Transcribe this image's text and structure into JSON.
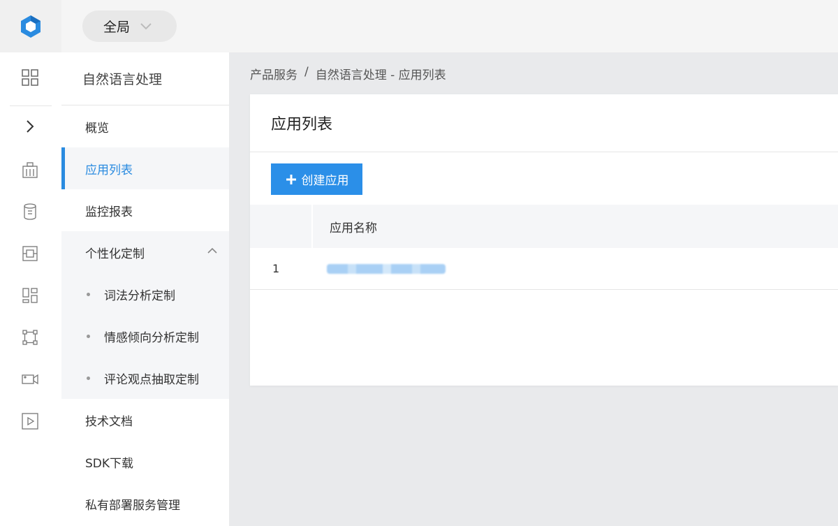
{
  "topbar": {
    "scope_label": "全局"
  },
  "rail": {
    "icons": [
      "logo-cube-icon",
      "grid-icon",
      "chevron-right-icon",
      "building-icon",
      "database-icon",
      "chip-icon",
      "dashboard-icon",
      "network-icon",
      "video-camera-icon",
      "play-icon"
    ]
  },
  "sidebar": {
    "title": "自然语言处理",
    "items": [
      {
        "label": "概览"
      },
      {
        "label": "应用列表"
      },
      {
        "label": "监控报表"
      },
      {
        "label": "个性化定制"
      },
      {
        "label": "技术文档"
      },
      {
        "label": "SDK下载"
      },
      {
        "label": "私有部署服务管理"
      }
    ],
    "sub_items": [
      {
        "label": "词法分析定制"
      },
      {
        "label": "情感倾向分析定制"
      },
      {
        "label": "评论观点抽取定制"
      }
    ]
  },
  "breadcrumb": {
    "root": "产品服务",
    "separator": "/",
    "current": "自然语言处理 - 应用列表"
  },
  "card": {
    "title": "应用列表",
    "create_button": "创建应用"
  },
  "table": {
    "headers": [
      "",
      "应用名称"
    ],
    "rows": [
      {
        "index": "1"
      }
    ]
  },
  "colors": {
    "accent": "#2a8be0",
    "button": "#2b8fe8"
  }
}
